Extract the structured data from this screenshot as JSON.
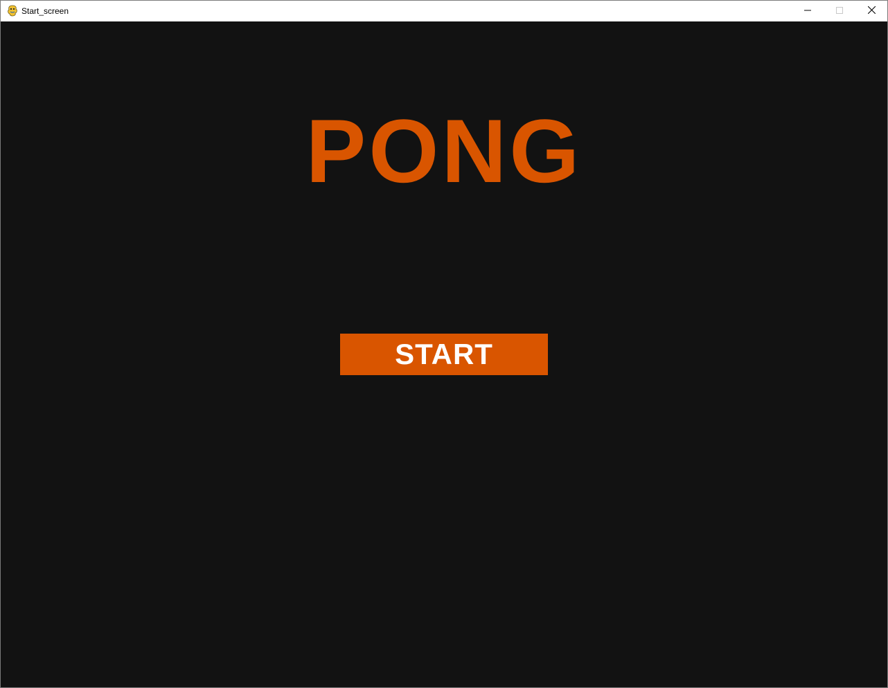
{
  "window": {
    "title": "Start_screen",
    "app_icon": "pygame-snake-icon",
    "controls": {
      "minimize_icon": "minimize-icon",
      "maximize_icon": "maximize-icon",
      "close_icon": "close-icon"
    }
  },
  "screen": {
    "background_color": "#121212",
    "title": "PONG",
    "title_color": "#d95500",
    "start_button": {
      "label": "START",
      "background_color": "#d95500",
      "text_color": "#ffffff"
    }
  }
}
